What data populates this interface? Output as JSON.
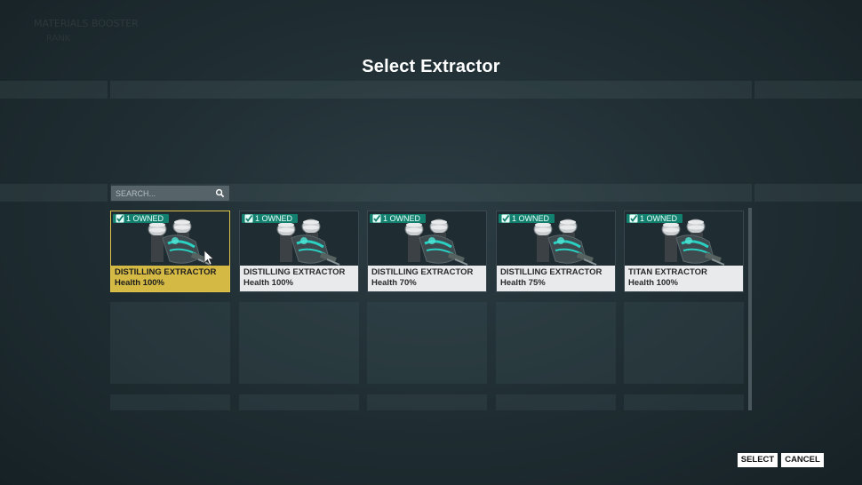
{
  "header": {
    "title": "Select Extractor",
    "faint_heading": "MATERIALS BOOSTER",
    "faint_sub": "RANK"
  },
  "search": {
    "placeholder": "SEARCH...",
    "value": ""
  },
  "items": [
    {
      "owned": "1 OWNED",
      "name": "DISTILLING EXTRACTOR",
      "health": "Health 100%",
      "selected": true
    },
    {
      "owned": "1 OWNED",
      "name": "DISTILLING EXTRACTOR",
      "health": "Health 100%",
      "selected": false
    },
    {
      "owned": "1 OWNED",
      "name": "DISTILLING EXTRACTOR",
      "health": "Health 70%",
      "selected": false
    },
    {
      "owned": "1 OWNED",
      "name": "DISTILLING EXTRACTOR",
      "health": "Health 75%",
      "selected": false
    },
    {
      "owned": "1 OWNED",
      "name": "TITAN EXTRACTOR",
      "health": "Health 100%",
      "selected": false
    }
  ],
  "buttons": {
    "select": "SELECT",
    "cancel": "CANCEL"
  },
  "colors": {
    "owned_badge": "#13806f",
    "selected_label": "#d4ba45",
    "selected_border": "#e0c24a"
  },
  "icons": {
    "search": "search-icon",
    "owned": "checkmark-icon",
    "item_art": "extractor-drone-icon"
  }
}
